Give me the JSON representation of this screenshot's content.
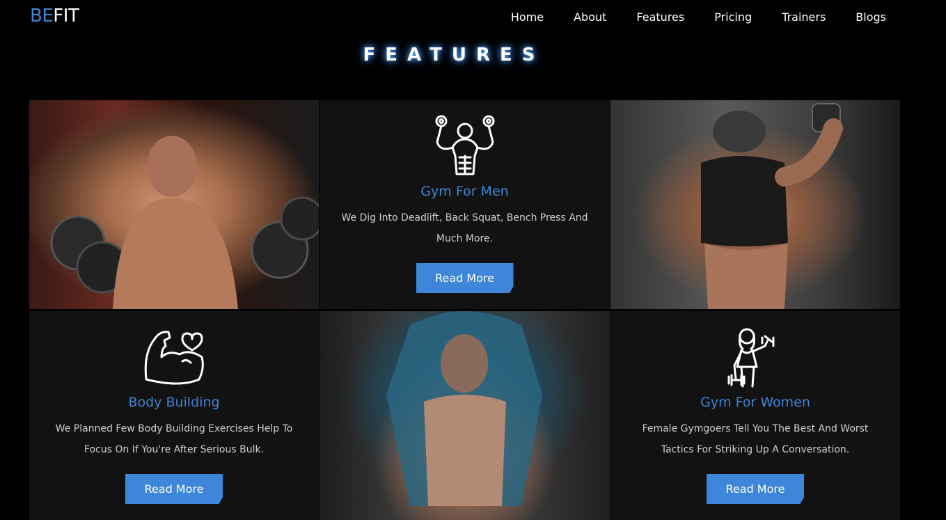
{
  "brand": {
    "part1": "BE",
    "part2": "FIT"
  },
  "nav": [
    "Home",
    "About",
    "Features",
    "Pricing",
    "Trainers",
    "Blogs"
  ],
  "section_title": "FEATURES",
  "features": [
    {
      "title": "Gym For Men",
      "description": "We Dig Into Deadlift, Back Squat, Bench Press And Much More.",
      "button": "Read More",
      "icon": "muscle-man-icon"
    },
    {
      "title": "Body Building",
      "description": "We Planned Few Body Building Exercises Help To Focus On If You're After Serious Bulk.",
      "button": "Read More",
      "icon": "flexed-arm-heart-icon"
    },
    {
      "title": "Gym For Women",
      "description": "Female Gymgoers Tell You The Best And Worst Tactics For Striking Up A Conversation.",
      "button": "Read More",
      "icon": "woman-dumbbell-icon"
    }
  ],
  "photos": [
    "man-with-dumbbells-photo",
    "woman-with-dumbbell-photo",
    "man-in-hoodie-photo"
  ],
  "colors": {
    "accent": "#3d86d9",
    "background": "#000000",
    "card": "#121212"
  }
}
